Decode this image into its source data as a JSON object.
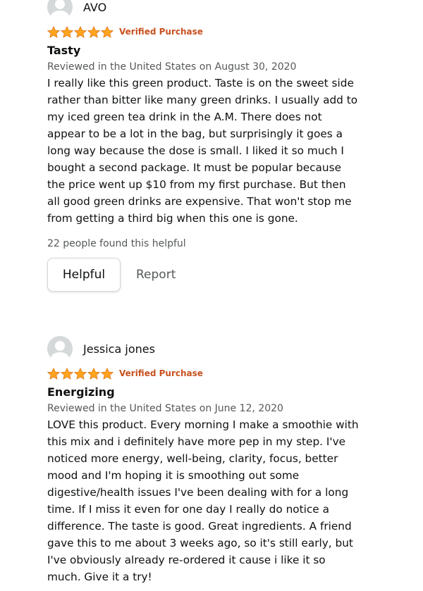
{
  "colors": {
    "star": "#ffa41c",
    "verified": "#c7511f",
    "muted_text": "#565959",
    "avatar_bg": "#d5d9d9"
  },
  "reviews": [
    {
      "author": "AVO",
      "rating": 5,
      "verified": "Verified Purchase",
      "title": "Tasty",
      "date": "Reviewed in the United States on August 30, 2020",
      "body": "I really like this green product. Taste is on the sweet side rather than bitter like many green drinks. I usually add to my iced green tea drink in the A.M. There does not appear to be a lot in the bag, but surprisingly it goes a long way because the dose is small. I liked it so much I bought a second package. It must be popular because the price went up $10 from my first purchase. But then all good green drinks are expensive. That won't stop me from getting a third big when this one is gone.",
      "helpful_count": "22 people found this helpful",
      "helpful_label": "Helpful",
      "report_label": "Report"
    },
    {
      "author": "Jessica jones",
      "rating": 5,
      "verified": "Verified Purchase",
      "title": "Energizing",
      "date": "Reviewed in the United States on June 12, 2020",
      "body": "LOVE this product. Every morning I make a smoothie with this mix and i definitely have more pep in my step. I've noticed more energy, well-being, clarity, focus, better mood and I'm hoping it is smoothing out some digestive/health issues I've been dealing with for a long time. If I miss it even for one day I really do notice a difference. The taste is good. Great ingredients. A friend gave this to me about 3 weeks ago, so it's still early, but I've obviously already re-ordered it cause i like it so much. Give it a try!"
    }
  ]
}
